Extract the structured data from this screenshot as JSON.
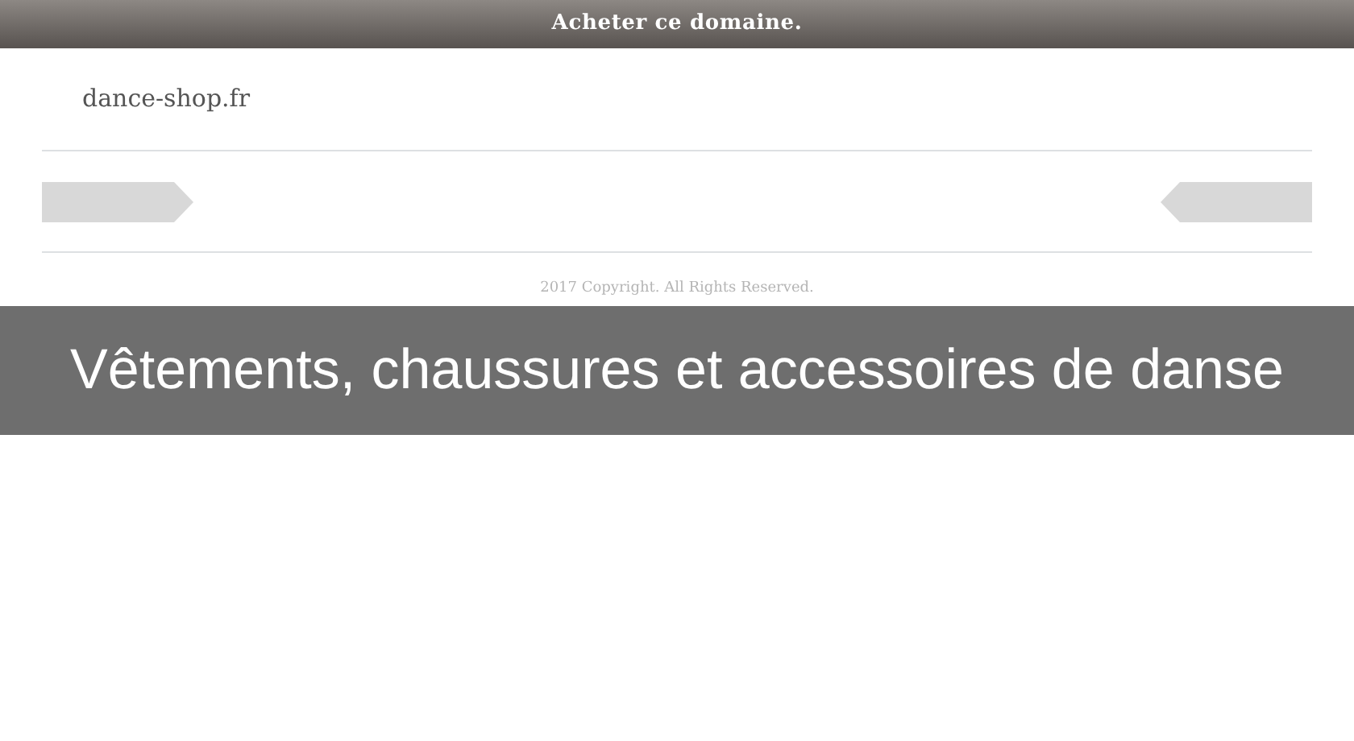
{
  "top_bar": {
    "link": "Acheter ce domaine."
  },
  "domain": "dance-shop.fr",
  "footer": {
    "copyright": "2017 Copyright. All Rights Reserved."
  },
  "caption": "Vêtements, chaussures et accessoires de danse"
}
